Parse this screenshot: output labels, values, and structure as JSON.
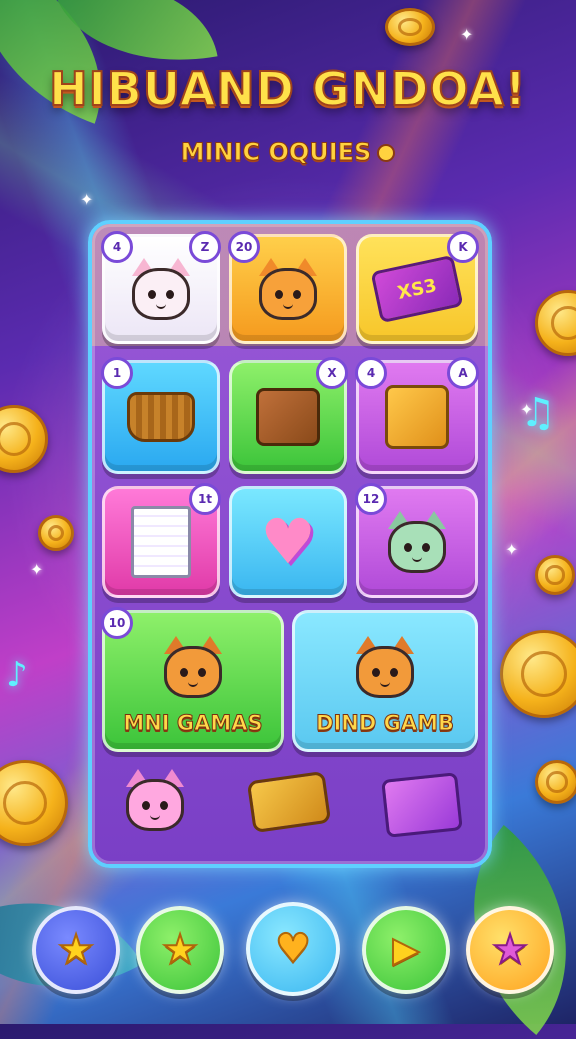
{
  "header": {
    "title": "HIBUAND GNDOA!",
    "subtitle": "MINIC OQUIES"
  },
  "grid": {
    "row1": [
      {
        "badge_left": "4",
        "badge_right": "Z"
      },
      {
        "badge_left": "20"
      },
      {
        "badge_right": "K",
        "sign_text": "XS3"
      }
    ],
    "row2": [
      {
        "badge_left": "1"
      },
      {
        "badge_right": "X"
      },
      {
        "badge_left": "4",
        "badge_right": "A"
      }
    ],
    "row3": [
      {
        "badge_right": "1t"
      },
      {},
      {
        "badge_left": "12"
      }
    ],
    "featured": [
      {
        "label": "MNI GAMAS",
        "badge": "10"
      },
      {
        "label": "DIND GAMB"
      }
    ]
  },
  "bottom_nav": [
    {
      "icon": "star-icon",
      "glyph": "★",
      "color": "#3a4fd8"
    },
    {
      "icon": "star-icon",
      "glyph": "★",
      "color": "#3cc43a"
    },
    {
      "icon": "heart-icon",
      "glyph": "♥",
      "color": "#3ab6f0"
    },
    {
      "icon": "play-icon",
      "glyph": "▶",
      "color": "#3cc43a"
    },
    {
      "icon": "star-icon",
      "glyph": "★",
      "color": "#ffb21e"
    }
  ]
}
